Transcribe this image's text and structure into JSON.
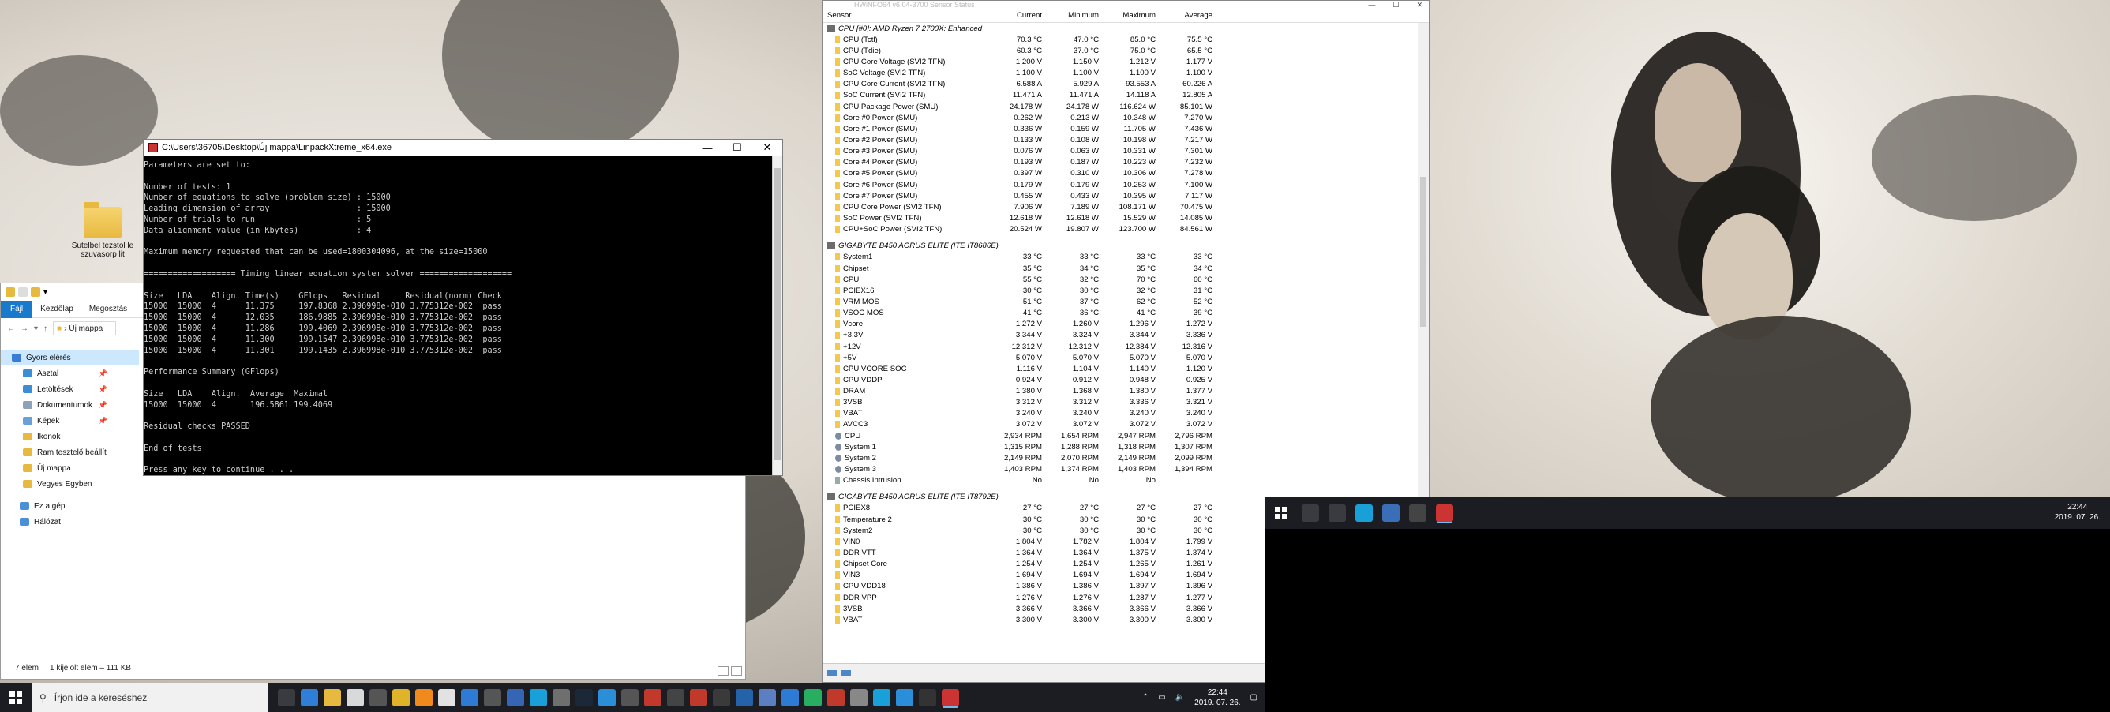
{
  "desktop1": {
    "icons": [
      {
        "label": "Sutelbel tezstol le szuvasorp lit"
      }
    ]
  },
  "console": {
    "title": "C:\\Users\\36705\\Desktop\\Új mappa\\LinpackXtreme_x64.exe",
    "text": "Parameters are set to:\n\nNumber of tests: 1\nNumber of equations to solve (problem size) : 15000\nLeading dimension of array                  : 15000\nNumber of trials to run                     : 5\nData alignment value (in Kbytes)            : 4\n\nMaximum memory requested that can be used=1800304096, at the size=15000\n\n=================== Timing linear equation system solver ===================\n\nSize   LDA    Align. Time(s)    GFlops   Residual     Residual(norm) Check\n15000  15000  4      11.375     197.8368 2.396998e-010 3.775312e-002  pass\n15000  15000  4      12.035     186.9885 2.396998e-010 3.775312e-002  pass\n15000  15000  4      11.286     199.4069 2.396998e-010 3.775312e-002  pass\n15000  15000  4      11.300     199.1547 2.396998e-010 3.775312e-002  pass\n15000  15000  4      11.301     199.1435 2.396998e-010 3.775312e-002  pass\n\nPerformance Summary (GFlops)\n\nSize   LDA    Align.  Average  Maximal\n15000  15000  4       196.5861 199.4069\n\nResidual checks PASSED\n\nEnd of tests\n\nPress any key to continue . . . _"
  },
  "explorer": {
    "ribbon": {
      "file": "Fájl",
      "home": "Kezdőlap",
      "share": "Megosztás"
    },
    "path": "Új mappa",
    "nav": [
      {
        "label": "Gyors elérés",
        "color": "#3a7bd5",
        "selected": true,
        "pin": false
      },
      {
        "label": "Asztal",
        "color": "#3a8ed5",
        "selected": false,
        "pin": true
      },
      {
        "label": "Letöltések",
        "color": "#3a8ed5",
        "selected": false,
        "pin": true
      },
      {
        "label": "Dokumentumok",
        "color": "#8fa3b8",
        "selected": false,
        "pin": true
      },
      {
        "label": "Képek",
        "color": "#6aa0d8",
        "selected": false,
        "pin": true
      },
      {
        "label": "Ikonok",
        "color": "#e7b93f",
        "selected": false,
        "pin": false
      },
      {
        "label": "Ram tesztelő beállít",
        "color": "#e7b93f",
        "selected": false,
        "pin": false
      },
      {
        "label": "Új mappa",
        "color": "#e7b93f",
        "selected": false,
        "pin": false
      },
      {
        "label": "Vegyes Egyben",
        "color": "#e7b93f",
        "selected": false,
        "pin": false
      },
      {
        "label": "Ez a gép",
        "color": "#4a8fd8",
        "selected": false,
        "pin": false
      },
      {
        "label": "Hálózat",
        "color": "#4a8fd8",
        "selected": false,
        "pin": false
      }
    ],
    "status_count": "7 elem",
    "status_selected": "1 kijelölt elem – 111 KB"
  },
  "hwinfo": {
    "title": "HWiNFO64 v6.04-3700 Sensor Status",
    "columns": {
      "sensor": "Sensor",
      "current": "Current",
      "minimum": "Minimum",
      "maximum": "Maximum",
      "average": "Average"
    },
    "groups": [
      {
        "name": "CPU [#0]: AMD Ryzen 7 2700X: Enhanced",
        "rows": [
          [
            "CPU (Tctl)",
            "70.3 °C",
            "47.0 °C",
            "85.0 °C",
            "75.5 °C",
            "t"
          ],
          [
            "CPU (Tdie)",
            "60.3 °C",
            "37.0 °C",
            "75.0 °C",
            "65.5 °C",
            "t"
          ],
          [
            "CPU Core Voltage (SVI2 TFN)",
            "1.200 V",
            "1.150 V",
            "1.212 V",
            "1.177 V",
            "v"
          ],
          [
            "SoC Voltage (SVI2 TFN)",
            "1.100 V",
            "1.100 V",
            "1.100 V",
            "1.100 V",
            "v"
          ],
          [
            "CPU Core Current (SVI2 TFN)",
            "6.588 A",
            "5.929 A",
            "93.553 A",
            "60.226 A",
            "v"
          ],
          [
            "SoC Current (SVI2 TFN)",
            "11.471 A",
            "11.471 A",
            "14.118 A",
            "12.805 A",
            "v"
          ],
          [
            "CPU Package Power (SMU)",
            "24.178 W",
            "24.178 W",
            "116.624 W",
            "85.101 W",
            "v"
          ],
          [
            "Core #0 Power (SMU)",
            "0.262 W",
            "0.213 W",
            "10.348 W",
            "7.270 W",
            "v"
          ],
          [
            "Core #1 Power (SMU)",
            "0.336 W",
            "0.159 W",
            "11.705 W",
            "7.436 W",
            "v"
          ],
          [
            "Core #2 Power (SMU)",
            "0.133 W",
            "0.108 W",
            "10.198 W",
            "7.217 W",
            "v"
          ],
          [
            "Core #3 Power (SMU)",
            "0.076 W",
            "0.063 W",
            "10.331 W",
            "7.301 W",
            "v"
          ],
          [
            "Core #4 Power (SMU)",
            "0.193 W",
            "0.187 W",
            "10.223 W",
            "7.232 W",
            "v"
          ],
          [
            "Core #5 Power (SMU)",
            "0.397 W",
            "0.310 W",
            "10.306 W",
            "7.278 W",
            "v"
          ],
          [
            "Core #6 Power (SMU)",
            "0.179 W",
            "0.179 W",
            "10.253 W",
            "7.100 W",
            "v"
          ],
          [
            "Core #7 Power (SMU)",
            "0.455 W",
            "0.433 W",
            "10.395 W",
            "7.117 W",
            "v"
          ],
          [
            "CPU Core Power (SVI2 TFN)",
            "7.906 W",
            "7.189 W",
            "108.171 W",
            "70.475 W",
            "v"
          ],
          [
            "SoC Power (SVI2 TFN)",
            "12.618 W",
            "12.618 W",
            "15.529 W",
            "14.085 W",
            "v"
          ],
          [
            "CPU+SoC Power (SVI2 TFN)",
            "20.524 W",
            "19.807 W",
            "123.700 W",
            "84.561 W",
            "v"
          ]
        ]
      },
      {
        "name": "GIGABYTE B450 AORUS ELITE (ITE IT8686E)",
        "rows": [
          [
            "System1",
            "33 °C",
            "33 °C",
            "33 °C",
            "33 °C",
            "t"
          ],
          [
            "Chipset",
            "35 °C",
            "34 °C",
            "35 °C",
            "34 °C",
            "t"
          ],
          [
            "CPU",
            "55 °C",
            "32 °C",
            "70 °C",
            "60 °C",
            "t"
          ],
          [
            "PCIEX16",
            "30 °C",
            "30 °C",
            "32 °C",
            "31 °C",
            "t"
          ],
          [
            "VRM MOS",
            "51 °C",
            "37 °C",
            "62 °C",
            "52 °C",
            "t"
          ],
          [
            "VSOC MOS",
            "41 °C",
            "36 °C",
            "41 °C",
            "39 °C",
            "t"
          ],
          [
            "Vcore",
            "1.272 V",
            "1.260 V",
            "1.296 V",
            "1.272 V",
            "v"
          ],
          [
            "+3.3V",
            "3.344 V",
            "3.324 V",
            "3.344 V",
            "3.336 V",
            "v"
          ],
          [
            "+12V",
            "12.312 V",
            "12.312 V",
            "12.384 V",
            "12.316 V",
            "v"
          ],
          [
            "+5V",
            "5.070 V",
            "5.070 V",
            "5.070 V",
            "5.070 V",
            "v"
          ],
          [
            "CPU VCORE SOC",
            "1.116 V",
            "1.104 V",
            "1.140 V",
            "1.120 V",
            "v"
          ],
          [
            "CPU VDDP",
            "0.924 V",
            "0.912 V",
            "0.948 V",
            "0.925 V",
            "v"
          ],
          [
            "DRAM",
            "1.380 V",
            "1.368 V",
            "1.380 V",
            "1.377 V",
            "v"
          ],
          [
            "3VSB",
            "3.312 V",
            "3.312 V",
            "3.336 V",
            "3.321 V",
            "v"
          ],
          [
            "VBAT",
            "3.240 V",
            "3.240 V",
            "3.240 V",
            "3.240 V",
            "v"
          ],
          [
            "AVCC3",
            "3.072 V",
            "3.072 V",
            "3.072 V",
            "3.072 V",
            "v"
          ],
          [
            "CPU",
            "2,934 RPM",
            "1,654 RPM",
            "2,947 RPM",
            "2,796 RPM",
            "f"
          ],
          [
            "System 1",
            "1,315 RPM",
            "1,288 RPM",
            "1,318 RPM",
            "1,307 RPM",
            "f"
          ],
          [
            "System 2",
            "2,149 RPM",
            "2,070 RPM",
            "2,149 RPM",
            "2,099 RPM",
            "f"
          ],
          [
            "System 3",
            "1,403 RPM",
            "1,374 RPM",
            "1,403 RPM",
            "1,394 RPM",
            "f"
          ],
          [
            "Chassis Intrusion",
            "No",
            "No",
            "No",
            "",
            "c"
          ]
        ]
      },
      {
        "name": "GIGABYTE B450 AORUS ELITE (ITE IT8792E)",
        "rows": [
          [
            "PCIEX8",
            "27 °C",
            "27 °C",
            "27 °C",
            "27 °C",
            "t"
          ],
          [
            "Temperature 2",
            "30 °C",
            "30 °C",
            "30 °C",
            "30 °C",
            "t"
          ],
          [
            "System2",
            "30 °C",
            "30 °C",
            "30 °C",
            "30 °C",
            "t"
          ],
          [
            "VIN0",
            "1.804 V",
            "1.782 V",
            "1.804 V",
            "1.799 V",
            "v"
          ],
          [
            "DDR VTT",
            "1.364 V",
            "1.364 V",
            "1.375 V",
            "1.374 V",
            "v"
          ],
          [
            "Chipset Core",
            "1.254 V",
            "1.254 V",
            "1.265 V",
            "1.261 V",
            "v"
          ],
          [
            "VIN3",
            "1.694 V",
            "1.694 V",
            "1.694 V",
            "1.694 V",
            "v"
          ],
          [
            "CPU VDD18",
            "1.386 V",
            "1.386 V",
            "1.397 V",
            "1.396 V",
            "v"
          ],
          [
            "DDR VPP",
            "1.276 V",
            "1.276 V",
            "1.287 V",
            "1.277 V",
            "v"
          ],
          [
            "3VSB",
            "3.366 V",
            "3.366 V",
            "3.366 V",
            "3.366 V",
            "v"
          ],
          [
            "VBAT",
            "3.300 V",
            "3.300 V",
            "3.300 V",
            "3.300 V",
            "v"
          ]
        ]
      }
    ]
  },
  "taskbar1": {
    "search_placeholder": "Írjon ide a kereséshez",
    "time": "22:44",
    "date": "2019. 07. 26.",
    "icons": [
      {
        "name": "task-view-icon",
        "color": "#3a3b41"
      },
      {
        "name": "edge-icon",
        "color": "#2f7ed8"
      },
      {
        "name": "file-explorer-icon",
        "color": "#e7b93f"
      },
      {
        "name": "store-icon",
        "color": "#d9d9d9"
      },
      {
        "name": "terminal-icon",
        "color": "#555"
      },
      {
        "name": "chrome-icon",
        "color": "#e0b429"
      },
      {
        "name": "vlc-icon",
        "color": "#f08a1c"
      },
      {
        "name": "app-icon-1",
        "color": "#e2e2e2"
      },
      {
        "name": "app-icon-2",
        "color": "#2d7bd5"
      },
      {
        "name": "calculator-icon",
        "color": "#555"
      },
      {
        "name": "hwinfo-icon",
        "color": "#3566b5"
      },
      {
        "name": "app-icon-3",
        "color": "#1aa0d8"
      },
      {
        "name": "app-icon-4",
        "color": "#6f6f6f"
      },
      {
        "name": "steam-icon",
        "color": "#1b2838"
      },
      {
        "name": "app-icon-5",
        "color": "#2a8fd8"
      },
      {
        "name": "app-icon-6",
        "color": "#555"
      },
      {
        "name": "ryzen-master-icon",
        "color": "#c0392b"
      },
      {
        "name": "app-icon-7",
        "color": "#444"
      },
      {
        "name": "record-icon",
        "color": "#c0392b"
      },
      {
        "name": "app-icon-8",
        "color": "#3a3a3a"
      },
      {
        "name": "app-icon-9",
        "color": "#2563a8"
      },
      {
        "name": "app-icon-10",
        "color": "#5b7fc0"
      },
      {
        "name": "app-icon-11",
        "color": "#2d7bd5"
      },
      {
        "name": "app-icon-12",
        "color": "#27ae60"
      },
      {
        "name": "app-icon-13",
        "color": "#c0392b"
      },
      {
        "name": "app-icon-14",
        "color": "#888"
      },
      {
        "name": "app-icon-15",
        "color": "#1aa0d8"
      },
      {
        "name": "app-icon-16",
        "color": "#2a8fd8"
      },
      {
        "name": "app-icon-17",
        "color": "#333"
      },
      {
        "name": "linpack-icon",
        "color": "#c33"
      }
    ]
  },
  "taskbar2": {
    "time": "22:44",
    "date": "2019. 07. 26.",
    "icons": [
      {
        "name": "search-icon",
        "color": "#3a3b41"
      },
      {
        "name": "task-view-icon",
        "color": "#3a3b41"
      },
      {
        "name": "app-icon-a",
        "color": "#1aa0d8"
      },
      {
        "name": "app-icon-b",
        "color": "#3a6fb8"
      },
      {
        "name": "app-icon-c",
        "color": "#444"
      },
      {
        "name": "linpack-icon",
        "color": "#c33"
      }
    ]
  }
}
